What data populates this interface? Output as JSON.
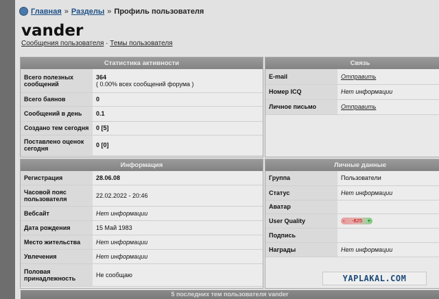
{
  "breadcrumb": {
    "home": "Главная",
    "sep": "»",
    "sections": "Разделы",
    "current": "Профиль пользователя"
  },
  "user": {
    "name": "vander",
    "link_posts": "Сообщения пользователя",
    "link_sep": "·",
    "link_topics": "Темы пользователя"
  },
  "activity": {
    "title": "Статистика активности",
    "rows": [
      {
        "label": "Всего полезных сообщений",
        "value": "364",
        "sub": "( 0.00% всех сообщений форума )"
      },
      {
        "label": "Всего баянов",
        "value": "0"
      },
      {
        "label": "Сообщений в день",
        "value": "0.1"
      },
      {
        "label": "Создано тем сегодня",
        "value": "0 [5]"
      },
      {
        "label": "Поставлено оценок сегодня",
        "value": "0 [0]"
      }
    ]
  },
  "contact": {
    "title": "Связь",
    "rows": [
      {
        "label": "E-mail",
        "value": "Отправить"
      },
      {
        "label": "Номер ICQ",
        "value": "Нет информации"
      },
      {
        "label": "Личное письмо",
        "value": "Отправить"
      }
    ]
  },
  "info": {
    "title": "Информация",
    "rows": [
      {
        "label": "Регистрация",
        "value": "28.06.08"
      },
      {
        "label": "Часовой пояс пользователя",
        "value": "22.02.2022 - 20:46"
      },
      {
        "label": "Вебсайт",
        "value": "Нет информации"
      },
      {
        "label": "Дата рождения",
        "value": "15 Май 1983"
      },
      {
        "label": "Место жительства",
        "value": "Нет информации"
      },
      {
        "label": "Увлечения",
        "value": "Нет информации"
      },
      {
        "label": "Половая принадлежность",
        "value": "Не сообщаю"
      }
    ]
  },
  "personal": {
    "title": "Личные данные",
    "rows": [
      {
        "label": "Группа",
        "value": "Пользователи"
      },
      {
        "label": "Статус",
        "value": "Нет информации"
      },
      {
        "label": "Аватар",
        "value": ""
      },
      {
        "label": "User Quality",
        "value": ""
      },
      {
        "label": "Подпись",
        "value": ""
      },
      {
        "label": "Награды",
        "value": "Нет информации"
      }
    ],
    "quality": {
      "minus": "-",
      "value": "-825",
      "plus": "+"
    }
  },
  "watermark": "YAPLAKAL.COM",
  "recent_topics_title": "5 последних тем пользователя vander"
}
